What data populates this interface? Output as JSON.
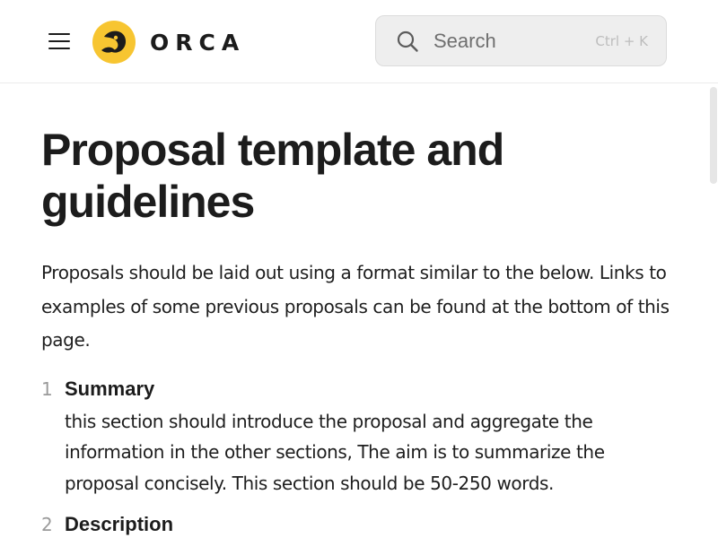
{
  "header": {
    "logo_text": "ORCA",
    "search": {
      "placeholder": "Search",
      "shortcut": "Ctrl + K"
    }
  },
  "icons": {
    "menu": "hamburger-menu-icon",
    "logo": "orca-logo-icon",
    "search": "magnifier-icon"
  },
  "colors": {
    "logo_yellow": "#F7C531",
    "text": "#1C1C1C",
    "search_bg": "#EEEEEE",
    "list_number": "#9A9A9A"
  },
  "main": {
    "title": "Proposal template and guidelines",
    "intro": "Proposals should be laid out using a format similar to the below. Links to examples of some previous proposals can be found at the bottom of this page.",
    "sections": [
      {
        "number": "1",
        "title": "Summary",
        "description": "this section should introduce the proposal and aggregate the information in the other sections, The aim is to summarize the proposal concisely. This section should be 50-250 words."
      },
      {
        "number": "2",
        "title": "Description",
        "description": ""
      }
    ]
  }
}
